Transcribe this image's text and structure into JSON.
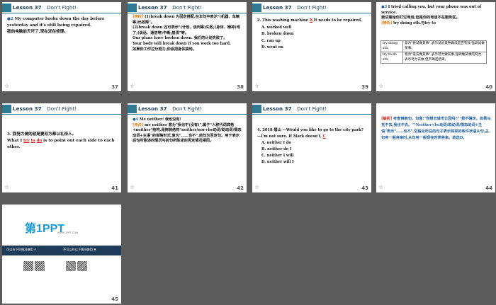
{
  "header_label": "Lesson 37",
  "header_title": "Don't Fight!",
  "star_icon": "☆",
  "slides": [
    {
      "num": "37",
      "q_marker": "●2",
      "en": "My computer broke down the day before yesterday and it's still being repaired.",
      "cn": "我的电脑前天坏了,现在还在修理。"
    },
    {
      "num": "38",
      "tag": "[辨析]",
      "lines": [
        "(1)break down 为固定搭配,在本句中表示\"(机器、车辆等)出故障\"。",
        "(2)break down 还可表示\"(计划、谈判等)失败;(身体、精神)垮了;(谈话、通信等)中断;崩溃\"等。",
        "Our plans have broken down. 我们的计划失败了。",
        "Your body will break down if you work too hard.",
        "如果你工作过分努力,你会把身体搞垮。"
      ]
    },
    {
      "num": "39",
      "q": "2. This washing machine",
      "answer": "B",
      "q_end": "It needs to be repaired.",
      "options": [
        "A. worked well",
        "B. broken down",
        "C. ran up",
        "D. went on"
      ]
    },
    {
      "num": "40",
      "q_marker": "●3",
      "en": "I tried calling you, but your phone was out of service.",
      "cn": "我试着给你打过电话,但是你的电话不在服务区。",
      "tag": "[辨析]",
      "tag_text": "try doing sth.与try to",
      "rows": [
        [
          "try doing sth.",
          "意为\"尝试做某事\",表示试验某种做法是否有效,强调试做某事。"
        ],
        [
          "try to do sth.",
          "意为\"设法做某事\",表示尽力做某事,强调做某事的努力,表示尽力去做,但不确定结果。"
        ]
      ]
    },
    {
      "num": "41",
      "q": "3. 我努力做的就是要双方都以礼待人。",
      "en_pre": "What I",
      "blank1": "try",
      "blank2": "to",
      "blank3": "do",
      "en_post": "is to point out each side to each other."
    },
    {
      "num": "42",
      "q_marker": "●4",
      "title_en": "Me neither!",
      "title_cn": "我也没有!",
      "tag": "[用法]",
      "text": "me neither 意为\"我也不(没有)\",属于\"人称代词宾格+neither\"结构,是倒装结构\"neither/nor+be动词/助动词/情态动词+主语\"的省略形式,意为\"……也不\",前句为否定句。用于表示后句所陈述的情况与前句所陈述的否定情况相同。"
    },
    {
      "num": "43",
      "q": "4. 2018·眉山 —Would you like to go to the city park?",
      "q2": "—I'm not sure. If Mark doesn't,",
      "answer": "C",
      "options": [
        "A. neither I do",
        "B. neither do I",
        "C. neither I will",
        "D. neither will I"
      ]
    },
    {
      "num": "44",
      "tag": "[解析]",
      "text": "考查倒装句。句意:\"你想去城市公园吗?\"\"我不确定。如果马克不去,我也不去。\"\"Neither+be动词/助动词/情态动词+主语\"表示\"……也不\",空格处所在的句子表示将来的条件状语从句,主句用一般将来时,从句用一般现在时表将来。故选D。"
    },
    {
      "num": "45",
      "logo_main": "第1PPT",
      "logo_sub": "WWW.1PPT.COM",
      "bar_left": "可以在下列情况使用 ✔",
      "bar_right": "不可以在以下情况使用 ✖"
    }
  ]
}
